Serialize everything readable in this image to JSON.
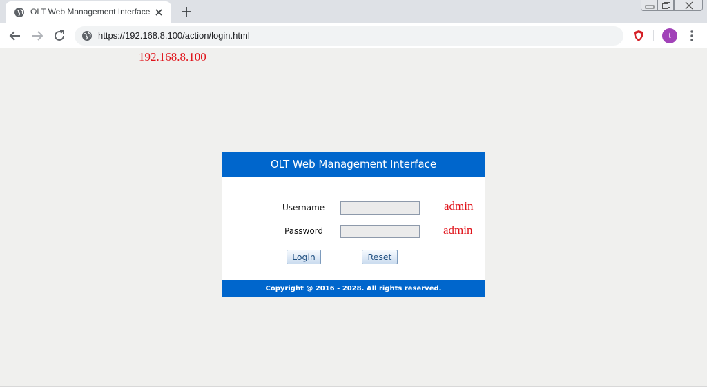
{
  "browser": {
    "tab_title": "OLT Web Management Interface",
    "url": "https://192.168.8.100/action/login.html",
    "avatar_initial": "t"
  },
  "page": {
    "ip_annotation": "192.168.8.100",
    "header_title": "OLT Web Management Interface",
    "username_label": "Username",
    "username_value": "",
    "username_hint": "admin",
    "password_label": "Password",
    "password_value": "",
    "password_hint": "admin",
    "login_label": "Login",
    "reset_label": "Reset",
    "copyright": "Copyright @ 2016 - 2028. All rights reserved."
  },
  "colors": {
    "panel_blue": "#0066cc",
    "annotation_red": "#e0141b",
    "page_background": "#f0f0ee"
  },
  "icons": [
    "globe-icon",
    "close-icon",
    "plus-icon",
    "back-arrow-icon",
    "forward-arrow-icon",
    "reload-icon",
    "site-info-icon",
    "shield-extension-icon",
    "more-menu-icon"
  ]
}
